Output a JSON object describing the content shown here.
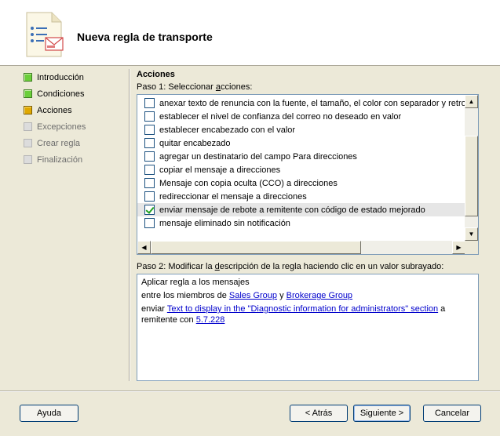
{
  "header": {
    "title": "Nueva regla de transporte",
    "icon": "rule-document-icon"
  },
  "nav": [
    {
      "label": "Introducción",
      "state": "done"
    },
    {
      "label": "Condiciones",
      "state": "done"
    },
    {
      "label": "Acciones",
      "state": "current"
    },
    {
      "label": "Excepciones",
      "state": "pending"
    },
    {
      "label": "Crear regla",
      "state": "pending"
    },
    {
      "label": "Finalización",
      "state": "pending"
    }
  ],
  "main": {
    "section_title": "Acciones",
    "step1_pre": "Paso 1: Seleccionar ",
    "step1_key": "a",
    "step1_post": "cciones:",
    "actions": [
      {
        "label": "anexar texto de renuncia con la fuente, el tamaño, el color con separador y retroce",
        "checked": false
      },
      {
        "label": "establecer el nivel de confianza del correo no deseado en valor",
        "checked": false
      },
      {
        "label": "establecer encabezado con el valor",
        "checked": false
      },
      {
        "label": "quitar encabezado",
        "checked": false
      },
      {
        "label": "agregar un destinatario del campo Para direcciones",
        "checked": false
      },
      {
        "label": "copiar el mensaje a direcciones",
        "checked": false
      },
      {
        "label": "Mensaje con copia oculta (CCO) a direcciones",
        "checked": false
      },
      {
        "label": "redireccionar el mensaje a direcciones",
        "checked": false
      },
      {
        "label": "enviar mensaje de rebote a remitente con código de estado mejorado",
        "checked": true
      },
      {
        "label": "mensaje eliminado sin notificación",
        "checked": false
      }
    ],
    "step2_pre": "Paso 2: Modificar la ",
    "step2_key": "d",
    "step2_post": "escripción de la regla haciendo clic en un valor subrayado:",
    "description": {
      "line1": "Aplicar regla a los mensajes",
      "line2_pre": "entre los miembros de ",
      "line2_link1": "Sales Group",
      "line2_mid": " y ",
      "line2_link2": "Brokerage Group",
      "line3_pre": "enviar ",
      "line3_link": "Text to display in the \"Diagnostic information for administrators\" section",
      "line3_post": " a",
      "line4_pre": "remitente con ",
      "line4_link": "5.7.228"
    }
  },
  "buttons": {
    "help": "Ayuda",
    "back": "< Atrás",
    "next": "Siguiente >",
    "cancel": "Cancelar"
  }
}
